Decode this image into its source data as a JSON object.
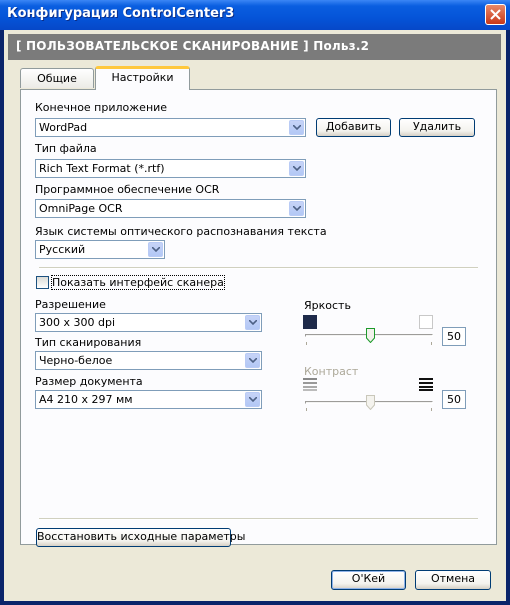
{
  "window": {
    "title": "Конфигурация ControlCenter3",
    "header": "[ ПОЛЬЗОВАТЕЛЬСКОЕ СКАНИРОВАНИЕ ]  Польз.2"
  },
  "tabs": [
    {
      "label": "Общие"
    },
    {
      "label": "Настройки",
      "active": true
    }
  ],
  "settings": {
    "target_app": {
      "label": "Конечное приложение",
      "value": "WordPad"
    },
    "add_button": "Добавить",
    "delete_button": "Удалить",
    "file_type": {
      "label": "Тип файла",
      "value": "Rich Text Format (*.rtf)"
    },
    "ocr_software": {
      "label": "Программное обеспечение OCR",
      "value": "OmniPage OCR"
    },
    "ocr_language": {
      "label": "Язык системы оптического распознавания текста",
      "value": "Русский"
    },
    "show_scanner_ui": {
      "label": "Показать интерфейс сканера",
      "checked": false
    },
    "resolution": {
      "label": "Разрешение",
      "value": "300 x 300 dpi"
    },
    "scan_type": {
      "label": "Тип сканирования",
      "value": "Черно-белое"
    },
    "document_size": {
      "label": "Размер документа",
      "value": "A4 210 x 297 мм"
    },
    "brightness": {
      "label": "Яркость",
      "value": "50",
      "enabled": true
    },
    "contrast": {
      "label": "Контраст",
      "value": "50",
      "enabled": false
    },
    "restore_defaults": "Восстановить исходные параметры"
  },
  "footer": {
    "ok": "О'Кей",
    "cancel": "Отмена"
  }
}
